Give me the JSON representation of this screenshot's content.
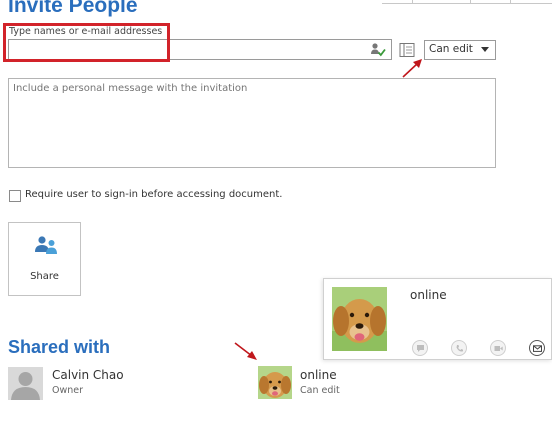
{
  "title": "Invite People",
  "invite": {
    "names_label": "Type names or e-mail addresses",
    "names_value": "",
    "permission": "Can edit",
    "message_placeholder": "Include a personal message with the invitation",
    "require_signin_label": "Require user to sign-in before accessing document.",
    "require_signin_checked": false,
    "share_label": "Share"
  },
  "shared_with": {
    "title": "Shared with",
    "users": [
      {
        "name": "Calvin Chao",
        "role": "Owner",
        "avatar": "placeholder-person-icon"
      },
      {
        "status": "online",
        "role": "Can edit",
        "avatar": "dog-photo"
      }
    ]
  },
  "contact_card": {
    "status": "online",
    "actions": [
      "im-icon",
      "call-icon",
      "video-icon",
      "email-icon"
    ]
  },
  "colors": {
    "heading_blue": "#2a6ebd",
    "highlight_red": "#d2232a",
    "arrow_red": "#c0171c",
    "share_icon_blue": "#3b78b5"
  }
}
